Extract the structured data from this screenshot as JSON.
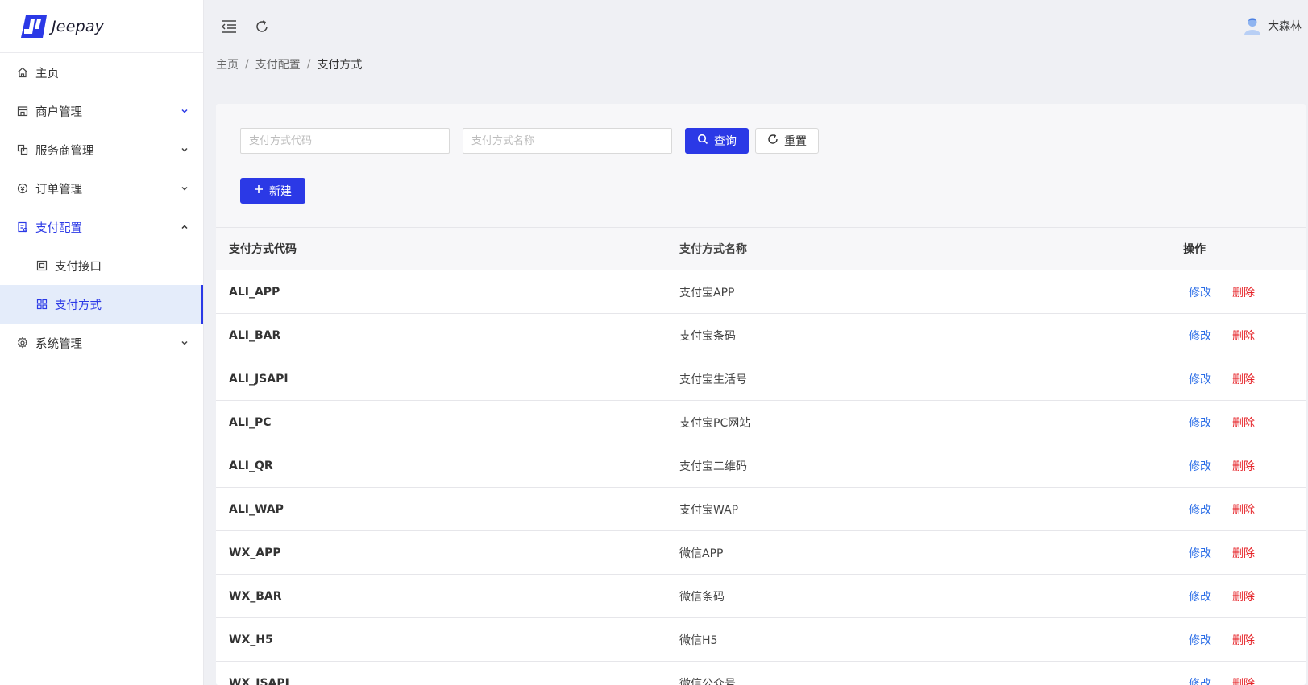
{
  "app": {
    "logo_text": "Jeepay"
  },
  "sidebar": {
    "items": [
      {
        "label": "主页",
        "icon": "home-icon"
      },
      {
        "label": "商户管理",
        "icon": "store-icon"
      },
      {
        "label": "服务商管理",
        "icon": "copy-icon"
      },
      {
        "label": "订单管理",
        "icon": "order-icon"
      },
      {
        "label": "支付配置",
        "icon": "pay-config-icon"
      },
      {
        "label": "支付接口",
        "icon": "interface-icon"
      },
      {
        "label": "支付方式",
        "icon": "grid-icon"
      },
      {
        "label": "系统管理",
        "icon": "gear-icon"
      }
    ]
  },
  "header": {
    "user_name": "大森林"
  },
  "breadcrumb": {
    "home": "主页",
    "section": "支付配置",
    "current": "支付方式",
    "separator": "/"
  },
  "search": {
    "code_placeholder": "支付方式代码",
    "name_placeholder": "支付方式名称",
    "query_label": "查询",
    "reset_label": "重置",
    "new_label": "新建"
  },
  "table": {
    "headers": {
      "code": "支付方式代码",
      "name": "支付方式名称",
      "actions": "操作"
    },
    "edit_label": "修改",
    "delete_label": "删除",
    "rows": [
      {
        "code": "ALI_APP",
        "name": "支付宝APP"
      },
      {
        "code": "ALI_BAR",
        "name": "支付宝条码"
      },
      {
        "code": "ALI_JSAPI",
        "name": "支付宝生活号"
      },
      {
        "code": "ALI_PC",
        "name": "支付宝PC网站"
      },
      {
        "code": "ALI_QR",
        "name": "支付宝二维码"
      },
      {
        "code": "ALI_WAP",
        "name": "支付宝WAP"
      },
      {
        "code": "WX_APP",
        "name": "微信APP"
      },
      {
        "code": "WX_BAR",
        "name": "微信条码"
      },
      {
        "code": "WX_H5",
        "name": "微信H5"
      },
      {
        "code": "WX_JSAPI",
        "name": "微信公众号"
      }
    ]
  },
  "colors": {
    "accent": "#2b39e6",
    "link": "#2b6de6",
    "danger": "#e6262b"
  }
}
